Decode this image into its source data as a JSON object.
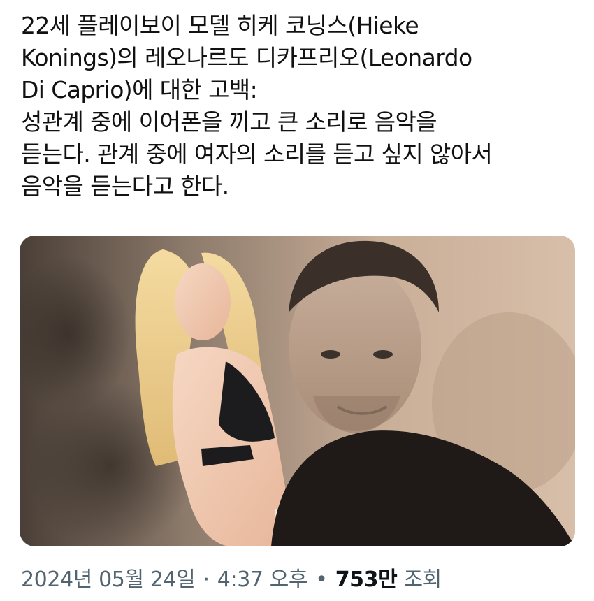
{
  "tweet": {
    "text": "22세 플레이보이 모델 히케 코닝스(Hieke\nKonings)의 레오나르도 디카프리오(Leonardo\nDi Caprio)에 대한 고백:\n성관계 중에 이어폰을 끼고 큰 소리로 음악을\n듣는다. 관계 중에 여자의 소리를 듣고 싶지 않아서\n음악을 듣는다고 한다."
  },
  "media": {
    "icon": "photo-collage"
  },
  "meta": {
    "date": "2024년 05월 24일",
    "separator": "·",
    "time": "4:37 오후",
    "separator2": "•",
    "views_count": "753만",
    "views_label": "조회"
  }
}
